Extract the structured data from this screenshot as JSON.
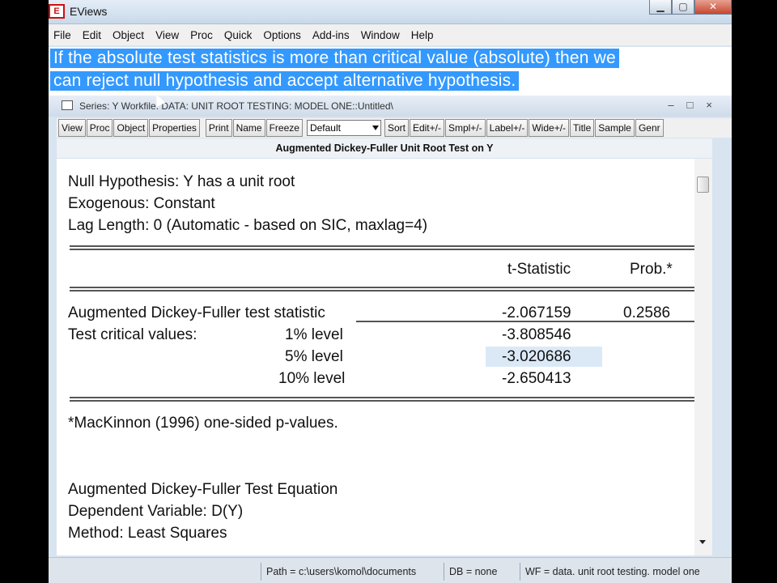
{
  "window": {
    "title": "EViews",
    "controls": {
      "minimize": "▁",
      "maximize": "▢",
      "close": "✕"
    }
  },
  "menu": [
    "File",
    "Edit",
    "Object",
    "View",
    "Proc",
    "Quick",
    "Options",
    "Add-ins",
    "Window",
    "Help"
  ],
  "annotation": {
    "line1": "If the absolute test statistics is more than critical value (absolute) then we",
    "line2": "can reject null hypothesis and accept alternative hypothesis."
  },
  "child_window": {
    "title": "Series: Y   Workfile: DATA: UNIT ROOT TESTING: MODEL ONE::Untitled\\",
    "controls": {
      "minimize": "–",
      "maximize": "□",
      "close": "×"
    }
  },
  "toolbar": {
    "left": [
      "View",
      "Proc",
      "Object",
      "Properties"
    ],
    "mid": [
      "Print",
      "Name",
      "Freeze"
    ],
    "select": "Default",
    "right": [
      "Sort",
      "Edit+/-",
      "Smpl+/-",
      "Label+/-",
      "Wide+/-",
      "Title",
      "Sample",
      "Genr"
    ]
  },
  "output": {
    "header": "Augmented Dickey-Fuller Unit Root Test on Y",
    "null_hypothesis": "Null Hypothesis: Y has a unit root",
    "exogenous": "Exogenous: Constant",
    "lag_length": "Lag Length: 0 (Automatic - based on SIC, maxlag=4)",
    "col_tstat": "t-Statistic",
    "col_prob": "Prob.*",
    "adf_label": "Augmented Dickey-Fuller test statistic",
    "adf_tstat": "-2.067159",
    "adf_prob": "0.2586",
    "critical_label": "Test critical values:",
    "critical": [
      {
        "level": "1% level",
        "value": "-3.808546"
      },
      {
        "level": "5% level",
        "value": "-3.020686"
      },
      {
        "level": "10% level",
        "value": "-2.650413"
      }
    ],
    "footnote": "*MacKinnon (1996) one-sided p-values.",
    "eq_title": "Augmented Dickey-Fuller Test Equation",
    "dep_var": "Dependent Variable: D(Y)",
    "method": "Method: Least Squares"
  },
  "status": {
    "path": "Path = c:\\users\\komol\\documents",
    "db": "DB = none",
    "wf": "WF = data. unit root testing. model one"
  },
  "colors": {
    "annotation_bg": "#3399ff",
    "highlight": "#dbe9f7"
  }
}
